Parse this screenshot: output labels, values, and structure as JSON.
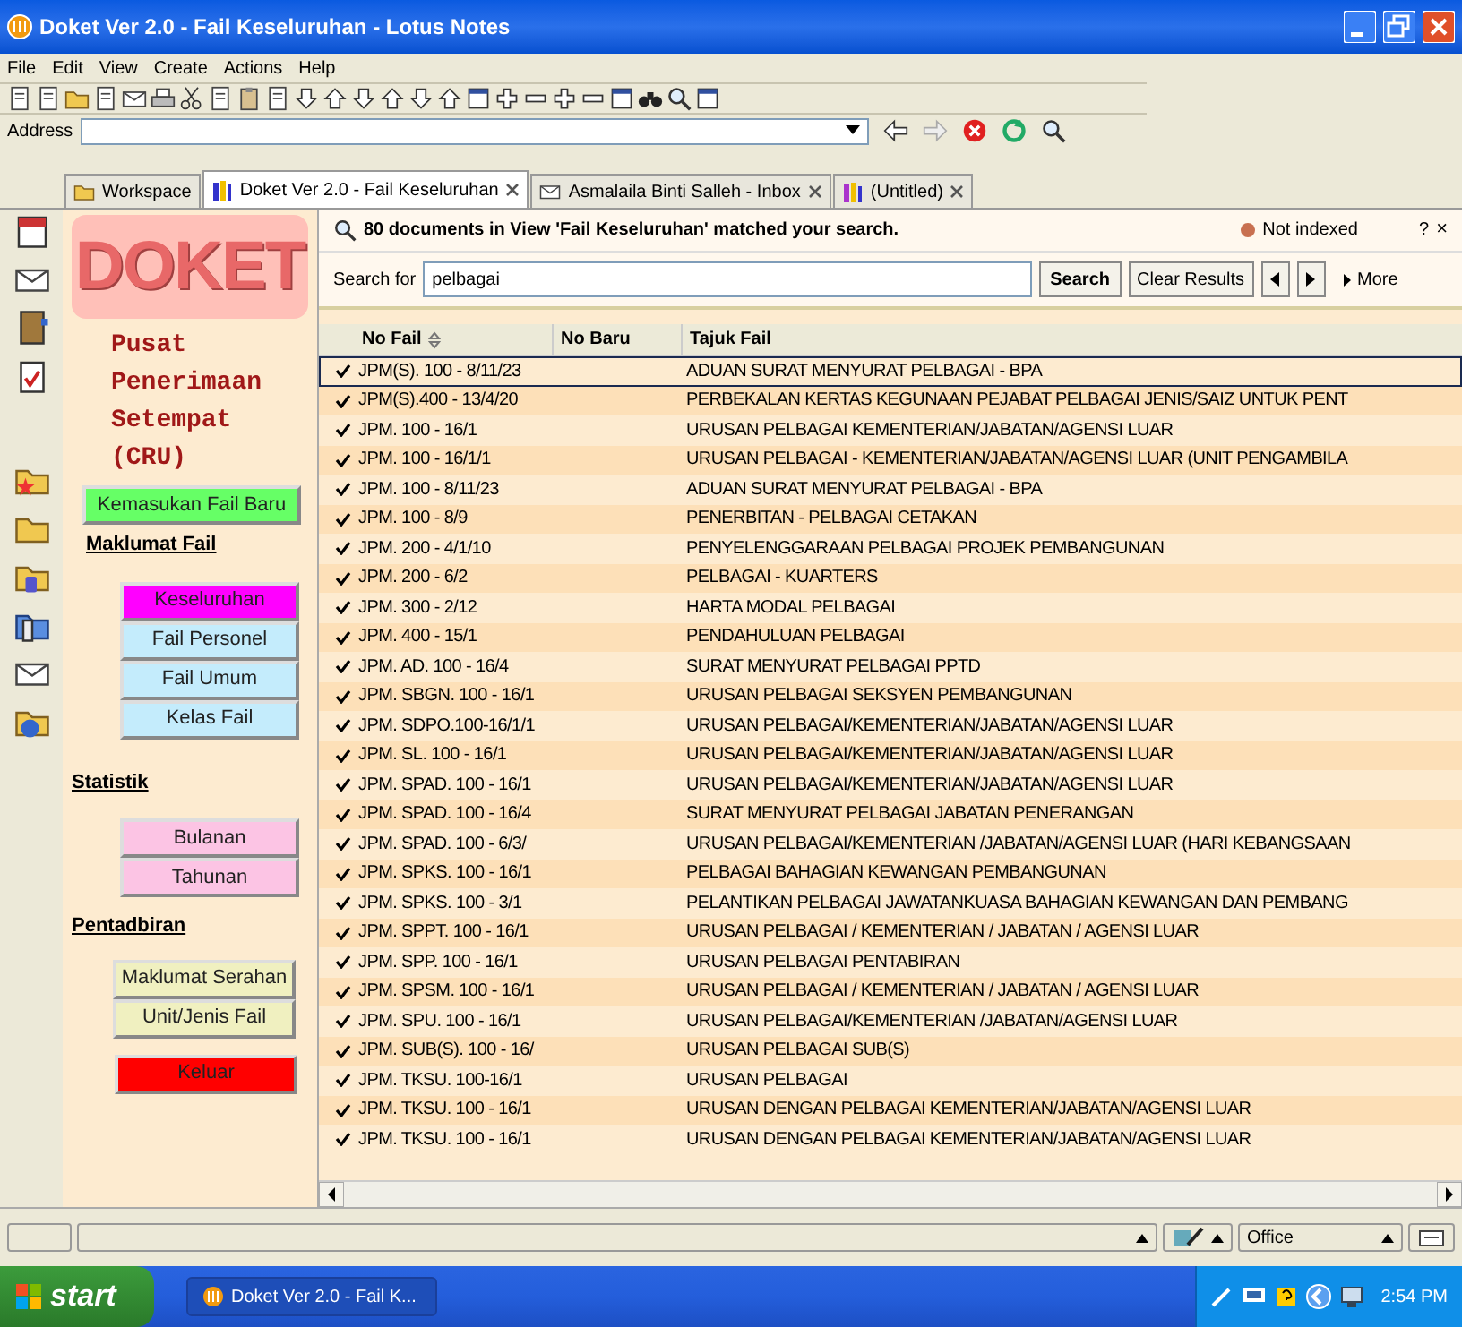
{
  "window": {
    "title": "Doket Ver 2.0 - Fail Keseluruhan - Lotus Notes"
  },
  "menu": [
    "File",
    "Edit",
    "View",
    "Create",
    "Actions",
    "Help"
  ],
  "address": {
    "label": "Address"
  },
  "tabs": [
    {
      "label": "Workspace",
      "selected": false,
      "closable": false
    },
    {
      "label": "Doket Ver 2.0 - Fail Keseluruhan",
      "selected": true,
      "closable": true
    },
    {
      "label": "Asmalaila Binti Salleh - Inbox",
      "selected": false,
      "closable": true
    },
    {
      "label": "(Untitled)",
      "selected": false,
      "closable": true
    }
  ],
  "nav": {
    "logo": "DOKET",
    "subtitle": "Pusat Penerimaan Setempat (CRU)",
    "new_button": {
      "label": "Kemasukan Fail Baru",
      "color": "#66ff66"
    },
    "sections": [
      {
        "heading": "Maklumat Fail",
        "color": "#c4ecfc",
        "items": [
          {
            "label": "Keseluruhan",
            "selected": true
          },
          {
            "label": "Fail Personel",
            "selected": false
          },
          {
            "label": "Fail Umum",
            "selected": false
          },
          {
            "label": "Kelas Fail",
            "selected": false
          }
        ]
      },
      {
        "heading": "Statistik",
        "color": "#fcc4e4",
        "items": [
          {
            "label": "Bulanan",
            "selected": false
          },
          {
            "label": "Tahunan",
            "selected": false
          }
        ]
      },
      {
        "heading": "Pentadbiran",
        "color": "#f0f0c0",
        "items": [
          {
            "label": "Maklumat Serahan",
            "selected": false
          },
          {
            "label": "Unit/Jenis Fail",
            "selected": false
          }
        ]
      }
    ],
    "exit_button": {
      "label": "Keluar",
      "color": "#ff0000"
    }
  },
  "search": {
    "result": "80 documents in View 'Fail Keseluruhan' matched your search.",
    "index_status": "Not indexed",
    "help": "?",
    "close": "×",
    "label": "Search for",
    "value": "pelbagai",
    "search_button": "Search",
    "clear_button": "Clear Results",
    "more": "More"
  },
  "table": {
    "columns": [
      "No Fail",
      "No Baru",
      "Tajuk Fail"
    ],
    "rows": [
      {
        "no_fail": "JPM(S). 100 - 8/11/23",
        "tajuk": "ADUAN SURAT MENYURAT PELBAGAI - BPA",
        "checked": true,
        "selected": true
      },
      {
        "no_fail": "JPM(S).400 - 13/4/20",
        "tajuk": "PERBEKALAN KERTAS KEGUNAAN PEJABAT PELBAGAI JENIS/SAIZ UNTUK PENT",
        "checked": true,
        "selected": false
      },
      {
        "no_fail": "JPM. 100 - 16/1",
        "tajuk": "URUSAN PELBAGAI KEMENTERIAN/JABATAN/AGENSI LUAR",
        "checked": true,
        "selected": false
      },
      {
        "no_fail": "JPM. 100 - 16/1/1",
        "tajuk": "URUSAN PELBAGAI - KEMENTERIAN/JABATAN/AGENSI LUAR (UNIT PENGAMBILA",
        "checked": true,
        "selected": false
      },
      {
        "no_fail": "JPM. 100 - 8/11/23",
        "tajuk": "ADUAN SURAT MENYURAT PELBAGAI - BPA",
        "checked": true,
        "selected": false
      },
      {
        "no_fail": "JPM. 100 - 8/9",
        "tajuk": "PENERBITAN - PELBAGAI CETAKAN",
        "checked": true,
        "selected": false
      },
      {
        "no_fail": "JPM. 200 - 4/1/10",
        "tajuk": "PENYELENGGARAAN PELBAGAI PROJEK PEMBANGUNAN",
        "checked": true,
        "selected": false
      },
      {
        "no_fail": "JPM. 200 - 6/2",
        "tajuk": "PELBAGAI - KUARTERS",
        "checked": true,
        "selected": false
      },
      {
        "no_fail": "JPM. 300 - 2/12",
        "tajuk": "HARTA MODAL PELBAGAI",
        "checked": true,
        "selected": false
      },
      {
        "no_fail": "JPM. 400 - 15/1",
        "tajuk": "PENDAHULUAN PELBAGAI",
        "checked": true,
        "selected": false
      },
      {
        "no_fail": "JPM. AD. 100 - 16/4",
        "tajuk": "SURAT MENYURAT PELBAGAI PPTD",
        "checked": true,
        "selected": false
      },
      {
        "no_fail": "JPM. SBGN. 100 - 16/1",
        "tajuk": "URUSAN PELBAGAI SEKSYEN PEMBANGUNAN",
        "checked": true,
        "selected": false
      },
      {
        "no_fail": "JPM. SDPO.100-16/1/1",
        "tajuk": "URUSAN PELBAGAI/KEMENTERIAN/JABATAN/AGENSI LUAR",
        "checked": true,
        "selected": false
      },
      {
        "no_fail": "JPM. SL. 100 - 16/1",
        "tajuk": "URUSAN PELBAGAI/KEMENTERIAN/JABATAN/AGENSI LUAR",
        "checked": true,
        "selected": false
      },
      {
        "no_fail": "JPM. SPAD. 100 - 16/1",
        "tajuk": "URUSAN PELBAGAI/KEMENTERIAN/JABATAN/AGENSI LUAR",
        "checked": true,
        "selected": false
      },
      {
        "no_fail": "JPM. SPAD. 100 - 16/4",
        "tajuk": "SURAT MENYURAT PELBAGAI JABATAN PENERANGAN",
        "checked": true,
        "selected": false
      },
      {
        "no_fail": "JPM. SPAD. 100 - 6/3/",
        "tajuk": "URUSAN PELBAGAI/KEMENTERIAN /JABATAN/AGENSI LUAR (HARI KEBANGSAAN",
        "checked": true,
        "selected": false
      },
      {
        "no_fail": "JPM. SPKS. 100 - 16/1",
        "tajuk": "PELBAGAI BAHAGIAN KEWANGAN PEMBANGUNAN",
        "checked": true,
        "selected": false
      },
      {
        "no_fail": "JPM. SPKS. 100 - 3/1",
        "tajuk": "PELANTIKAN PELBAGAI JAWATANKUASA BAHAGIAN KEWANGAN DAN PEMBANG",
        "checked": true,
        "selected": false
      },
      {
        "no_fail": "JPM. SPPT. 100 - 16/1",
        "tajuk": "URUSAN PELBAGAI / KEMENTERIAN / JABATAN / AGENSI LUAR",
        "checked": true,
        "selected": false
      },
      {
        "no_fail": "JPM. SPP. 100 - 16/1",
        "tajuk": "URUSAN PELBAGAI PENTABIRAN",
        "checked": true,
        "selected": false
      },
      {
        "no_fail": "JPM. SPSM. 100 - 16/1",
        "tajuk": "URUSAN PELBAGAI / KEMENTERIAN / JABATAN / AGENSI LUAR",
        "checked": true,
        "selected": false
      },
      {
        "no_fail": "JPM. SPU. 100 - 16/1",
        "tajuk": "URUSAN PELBAGAI/KEMENTERIAN /JABATAN/AGENSI LUAR",
        "checked": true,
        "selected": false
      },
      {
        "no_fail": "JPM. SUB(S). 100 - 16/",
        "tajuk": "URUSAN PELBAGAI SUB(S)",
        "checked": true,
        "selected": false
      },
      {
        "no_fail": "JPM. TKSU. 100-16/1",
        "tajuk": "URUSAN PELBAGAI",
        "checked": true,
        "selected": false
      },
      {
        "no_fail": "JPM. TKSU. 100 - 16/1",
        "tajuk": "URUSAN DENGAN PELBAGAI KEMENTERIAN/JABATAN/AGENSI LUAR",
        "checked": true,
        "selected": false
      },
      {
        "no_fail": "JPM. TKSU. 100 - 16/1",
        "tajuk": "URUSAN DENGAN PELBAGAI KEMENTERIAN/JABATAN/AGENSI LUAR",
        "checked": true,
        "selected": false
      }
    ]
  },
  "status_bar": {
    "location": "Office"
  },
  "taskbar": {
    "start": "start",
    "task": "Doket Ver 2.0 - Fail K...",
    "clock": "2:54 PM"
  }
}
